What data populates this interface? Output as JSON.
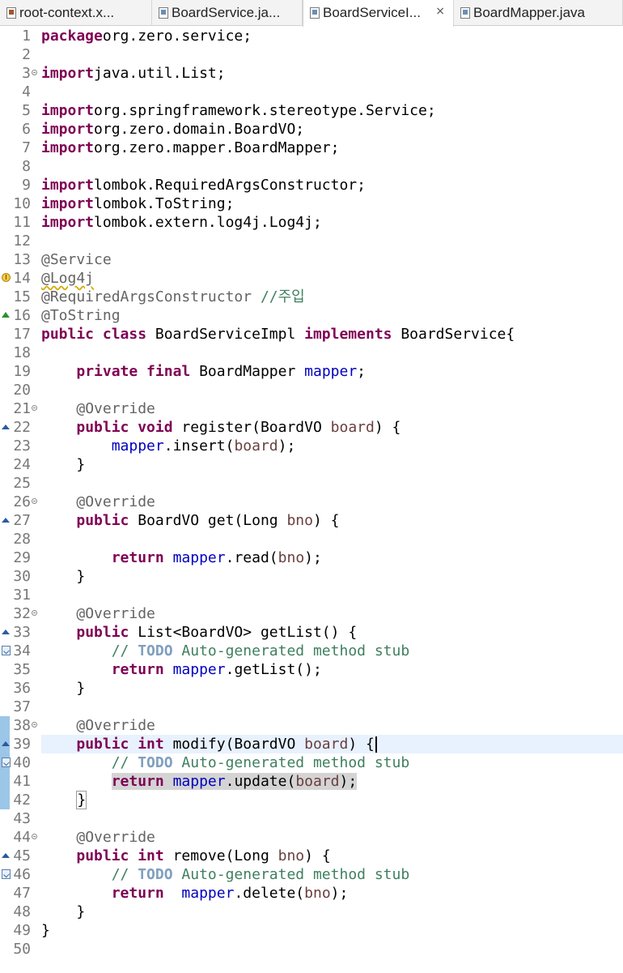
{
  "tabs": [
    {
      "label": "root-context.x...",
      "icon": "xml-file-icon",
      "active": false
    },
    {
      "label": "BoardService.ja...",
      "icon": "java-file-icon",
      "active": false
    },
    {
      "label": "BoardServiceI...",
      "icon": "java-file-icon",
      "active": true,
      "close": "⨯"
    },
    {
      "label": "BoardMapper.java",
      "icon": "java-file-icon",
      "active": false
    }
  ],
  "colors": {
    "keyword": "#7f0055",
    "annotation": "#646464",
    "field": "#0000c0",
    "parameter": "#6a3e3e",
    "comment": "#3f7f5f",
    "todo": "#7f9fbf",
    "line_number": "#787878",
    "current_line": "#e8f2fe",
    "change_bar": "#9bc6e8"
  },
  "code": {
    "lines": [
      {
        "n": "1",
        "t": [
          [
            "kw",
            "package"
          ],
          [
            "",
            "org.zero.service;"
          ]
        ]
      },
      {
        "n": "2",
        "t": []
      },
      {
        "n": "3",
        "fold": true,
        "t": [
          [
            "kw",
            "import"
          ],
          [
            "",
            "java.util.List;"
          ]
        ]
      },
      {
        "n": "4",
        "t": []
      },
      {
        "n": "5",
        "t": [
          [
            "kw",
            "import"
          ],
          [
            "",
            "org.springframework.stereotype.Service;"
          ]
        ]
      },
      {
        "n": "6",
        "t": [
          [
            "kw",
            "import"
          ],
          [
            "",
            "org.zero.domain.BoardVO;"
          ]
        ]
      },
      {
        "n": "7",
        "t": [
          [
            "kw",
            "import"
          ],
          [
            "",
            "org.zero.mapper.BoardMapper;"
          ]
        ]
      },
      {
        "n": "8",
        "t": []
      },
      {
        "n": "9",
        "t": [
          [
            "kw",
            "import"
          ],
          [
            "",
            "lombok.RequiredArgsConstructor;"
          ]
        ]
      },
      {
        "n": "10",
        "t": [
          [
            "kw",
            "import"
          ],
          [
            "",
            "lombok.ToString;"
          ]
        ]
      },
      {
        "n": "11",
        "t": [
          [
            "kw",
            "import"
          ],
          [
            "",
            "lombok.extern.log4j.Log4j;"
          ]
        ]
      },
      {
        "n": "12",
        "t": []
      },
      {
        "n": "13",
        "t": [
          [
            "ann",
            "@Service"
          ]
        ]
      },
      {
        "n": "14",
        "marker": "warning",
        "t": [
          [
            "ann squig",
            "@Log4j"
          ]
        ]
      },
      {
        "n": "15",
        "t": [
          [
            "ann",
            "@RequiredArgsConstructor"
          ],
          [
            "",
            " "
          ],
          [
            "cmt",
            "//주입"
          ]
        ]
      },
      {
        "n": "16",
        "marker": "implements",
        "t": [
          [
            "ann",
            "@ToString"
          ]
        ]
      },
      {
        "n": "17",
        "t": [
          [
            "kw",
            "public class"
          ],
          [
            "",
            " BoardServiceImpl "
          ],
          [
            "kw",
            "implements"
          ],
          [
            "",
            " BoardService{"
          ]
        ]
      },
      {
        "n": "18",
        "t": []
      },
      {
        "n": "19",
        "t": [
          [
            "",
            "    "
          ],
          [
            "kw",
            "private final"
          ],
          [
            "",
            " BoardMapper "
          ],
          [
            "fld",
            "mapper"
          ],
          [
            "",
            ";"
          ]
        ]
      },
      {
        "n": "20",
        "t": []
      },
      {
        "n": "21",
        "fold": true,
        "t": [
          [
            "",
            "    "
          ],
          [
            "ann",
            "@Override"
          ]
        ]
      },
      {
        "n": "22",
        "marker": "override",
        "t": [
          [
            "",
            "    "
          ],
          [
            "kw",
            "public void"
          ],
          [
            "",
            " register(BoardVO "
          ],
          [
            "par",
            "board"
          ],
          [
            "",
            ") {"
          ]
        ]
      },
      {
        "n": "23",
        "t": [
          [
            "",
            "        "
          ],
          [
            "fld",
            "mapper"
          ],
          [
            "",
            ".insert("
          ],
          [
            "par",
            "board"
          ],
          [
            "",
            ");"
          ]
        ]
      },
      {
        "n": "24",
        "t": [
          [
            "",
            "    }"
          ]
        ]
      },
      {
        "n": "25",
        "t": []
      },
      {
        "n": "26",
        "fold": true,
        "t": [
          [
            "",
            "    "
          ],
          [
            "ann",
            "@Override"
          ]
        ]
      },
      {
        "n": "27",
        "marker": "override",
        "t": [
          [
            "",
            "    "
          ],
          [
            "kw",
            "public"
          ],
          [
            "",
            " BoardVO get(Long "
          ],
          [
            "par",
            "bno"
          ],
          [
            "",
            ") {"
          ]
        ]
      },
      {
        "n": "28",
        "t": []
      },
      {
        "n": "29",
        "t": [
          [
            "",
            "        "
          ],
          [
            "kw",
            "return"
          ],
          [
            "",
            " "
          ],
          [
            "fld",
            "mapper"
          ],
          [
            "",
            ".read("
          ],
          [
            "par",
            "bno"
          ],
          [
            "",
            ");"
          ]
        ]
      },
      {
        "n": "30",
        "t": [
          [
            "",
            "    }"
          ]
        ]
      },
      {
        "n": "31",
        "t": []
      },
      {
        "n": "32",
        "fold": true,
        "t": [
          [
            "",
            "    "
          ],
          [
            "ann",
            "@Override"
          ]
        ]
      },
      {
        "n": "33",
        "marker": "override",
        "t": [
          [
            "",
            "    "
          ],
          [
            "kw",
            "public"
          ],
          [
            "",
            " List<BoardVO> getList() {"
          ]
        ]
      },
      {
        "n": "34",
        "marker": "task",
        "t": [
          [
            "",
            "        "
          ],
          [
            "cmt",
            "// "
          ],
          [
            "todo",
            "TODO"
          ],
          [
            "cmt",
            " Auto-generated method stub"
          ]
        ]
      },
      {
        "n": "35",
        "t": [
          [
            "",
            "        "
          ],
          [
            "kw",
            "return"
          ],
          [
            "",
            " "
          ],
          [
            "fld",
            "mapper"
          ],
          [
            "",
            ".getList();"
          ]
        ]
      },
      {
        "n": "36",
        "t": [
          [
            "",
            "    }"
          ]
        ]
      },
      {
        "n": "37",
        "t": []
      },
      {
        "n": "38",
        "fold": true,
        "changed": true,
        "t": [
          [
            "",
            "    "
          ],
          [
            "ann",
            "@Override"
          ]
        ]
      },
      {
        "n": "39",
        "marker": "override",
        "changed": true,
        "current": true,
        "t": [
          [
            "",
            "    "
          ],
          [
            "kw",
            "public int"
          ],
          [
            "",
            " modify(BoardVO "
          ],
          [
            "par",
            "board"
          ],
          [
            "",
            ") {"
          ],
          [
            "cursor",
            ""
          ]
        ]
      },
      {
        "n": "40",
        "marker": "task",
        "changed": true,
        "t": [
          [
            "",
            "        "
          ],
          [
            "cmt",
            "// "
          ],
          [
            "todo",
            "TODO"
          ],
          [
            "cmt",
            " Auto-generated method stub"
          ]
        ]
      },
      {
        "n": "41",
        "changed": true,
        "t": [
          [
            "",
            "        "
          ],
          [
            "kw sel",
            "return"
          ],
          [
            "sel",
            " "
          ],
          [
            "fld sel",
            "mapper"
          ],
          [
            "sel",
            ".update("
          ],
          [
            "par sel",
            "board"
          ],
          [
            "sel",
            ");"
          ]
        ]
      },
      {
        "n": "42",
        "changed": true,
        "t": [
          [
            "",
            "    "
          ],
          [
            "bracketbox",
            "}"
          ]
        ]
      },
      {
        "n": "43",
        "t": []
      },
      {
        "n": "44",
        "fold": true,
        "t": [
          [
            "",
            "    "
          ],
          [
            "ann",
            "@Override"
          ]
        ]
      },
      {
        "n": "45",
        "marker": "override",
        "t": [
          [
            "",
            "    "
          ],
          [
            "kw",
            "public int"
          ],
          [
            "",
            " remove(Long "
          ],
          [
            "par",
            "bno"
          ],
          [
            "",
            ") {"
          ]
        ]
      },
      {
        "n": "46",
        "marker": "task",
        "t": [
          [
            "",
            "        "
          ],
          [
            "cmt",
            "// "
          ],
          [
            "todo",
            "TODO"
          ],
          [
            "cmt",
            " Auto-generated method stub"
          ]
        ]
      },
      {
        "n": "47",
        "t": [
          [
            "",
            "        "
          ],
          [
            "kw",
            "return"
          ],
          [
            "",
            "  "
          ],
          [
            "fld",
            "mapper"
          ],
          [
            "",
            ".delete("
          ],
          [
            "par",
            "bno"
          ],
          [
            "",
            ");"
          ]
        ]
      },
      {
        "n": "48",
        "t": [
          [
            "",
            "    }"
          ]
        ]
      },
      {
        "n": "49",
        "t": [
          [
            "",
            "}"
          ]
        ]
      },
      {
        "n": "50",
        "t": []
      }
    ]
  }
}
